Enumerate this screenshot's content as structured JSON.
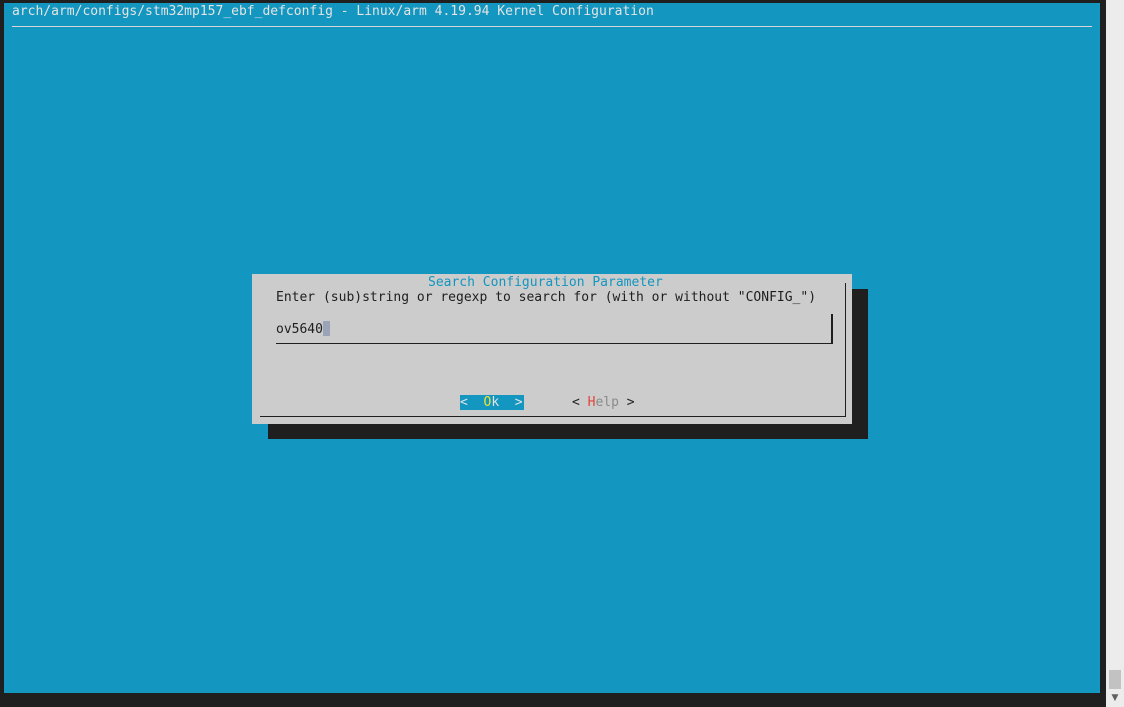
{
  "header": {
    "title": "arch/arm/configs/stm32mp157_ebf_defconfig - Linux/arm 4.19.94 Kernel Configuration"
  },
  "dialog": {
    "title": "Search Configuration Parameter",
    "prompt": "Enter (sub)string or regexp to search for (with or without \"CONFIG_\")",
    "input_value": "ov5640",
    "ok": {
      "left": "<  ",
      "hot": "O",
      "rest": "k  >"
    },
    "help": {
      "left": "< ",
      "hot": "H",
      "rest": "elp",
      "right": " >"
    }
  },
  "scrollbar": {
    "down_arrow": "▼"
  },
  "colors": {
    "terminal_background": "#1396bf",
    "dialog_background": "#cccccc",
    "hotkey_ok": "#f0e430",
    "hotkey_help": "#e0443c"
  }
}
